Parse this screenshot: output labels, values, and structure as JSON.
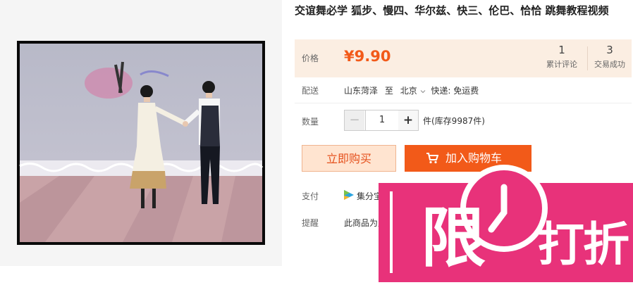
{
  "product": {
    "title": "交谊舞必学 狐步、慢四、华尔兹、快三、伦巴、恰恰 跳舞教程视频"
  },
  "price_section": {
    "label": "价格",
    "price": "¥9.90",
    "reviews_count": "1",
    "reviews_label": "累计评论",
    "trades_count": "3",
    "trades_label": "交易成功"
  },
  "shipping": {
    "label": "配送",
    "origin": "山东菏泽",
    "to_word": "至",
    "destination": "北京",
    "express": "快递: 免运费"
  },
  "quantity": {
    "label": "数量",
    "minus": "−",
    "value": "1",
    "plus": "+",
    "stock": "件(库存9987件)"
  },
  "actions": {
    "buy_now": "立即购买",
    "add_to_cart": "加入购物车"
  },
  "payment": {
    "label": "支付",
    "text": "集分宝"
  },
  "reminder": {
    "label": "提醒",
    "text": "此商品为虚拟商品"
  },
  "promo_badge": {
    "chars": [
      "限",
      "打",
      "折"
    ],
    "color": "#e8327a"
  },
  "colors": {
    "accent": "#f25a19",
    "price_bg": "#fbeee2",
    "promo": "#e8327a"
  }
}
